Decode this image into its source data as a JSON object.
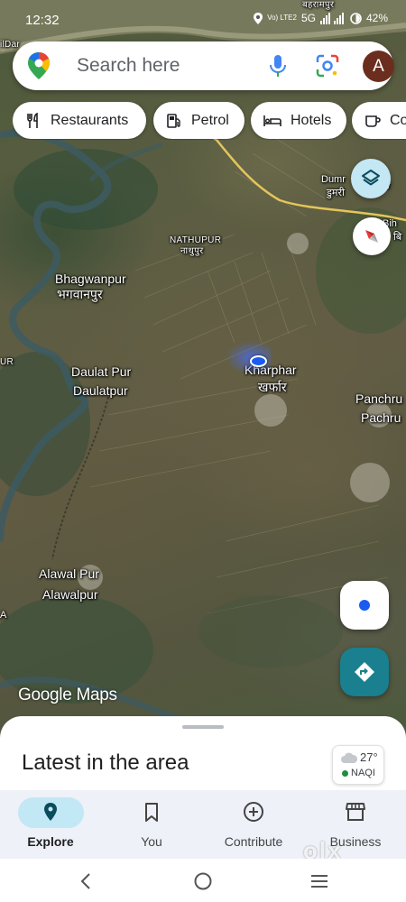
{
  "status_bar": {
    "time": "12:32",
    "network_line1": "Vo) LTE2",
    "network_5g": "5G",
    "battery": "42%"
  },
  "search": {
    "placeholder": "Search here",
    "avatar_initial": "A"
  },
  "chips": [
    {
      "label": "Restaurants",
      "icon": "fork-knife-icon"
    },
    {
      "label": "Petrol",
      "icon": "fuel-pump-icon"
    },
    {
      "label": "Hotels",
      "icon": "bed-icon"
    },
    {
      "label": "Co",
      "icon": "coffee-cup-icon"
    }
  ],
  "map": {
    "labels": {
      "top_left": "ilDar",
      "top_right_hindi": "बहरामपुर",
      "dumri_en": "Dumr",
      "dumri_hi": "डुमरी",
      "bihar_en": "Bih",
      "bihar_hi": "बि",
      "tan": "tar",
      "nathupur_en": "NATHUPUR",
      "nathupur_hi": "नाथुपुर",
      "bhagwanpur_en": "Bhagwanpur",
      "bhagwanpur_hi": "भगवानपुर",
      "ur": "UR",
      "daulatpur_en": "Daulat Pur",
      "daulatpur_hi": "Daulatpur",
      "kharphar_en": "Kharphar",
      "kharphar_hi": "खर्फार",
      "panchru_en": "Panchru",
      "panchru_hi": "Pachru",
      "alawalpur_en": "Alawal Pur",
      "alawalpur_hi": "Alawalpur",
      "a_left": "A"
    },
    "watermark": "Google Maps"
  },
  "sheet": {
    "title": "Latest in the area",
    "weather_temp": "27°",
    "aqi": "NAQI"
  },
  "bottom_nav": [
    {
      "label": "Explore",
      "icon": "location-pin-icon",
      "active": true
    },
    {
      "label": "You",
      "icon": "bookmark-icon",
      "active": false
    },
    {
      "label": "Contribute",
      "icon": "add-circle-icon",
      "active": false
    },
    {
      "label": "Business",
      "icon": "storefront-icon",
      "active": false
    }
  ],
  "overlay_watermark": "olx",
  "colors": {
    "accent_teal": "#1a7f8e",
    "explore_pill": "#c2e7f5",
    "location_blue": "#1a5cf0"
  }
}
